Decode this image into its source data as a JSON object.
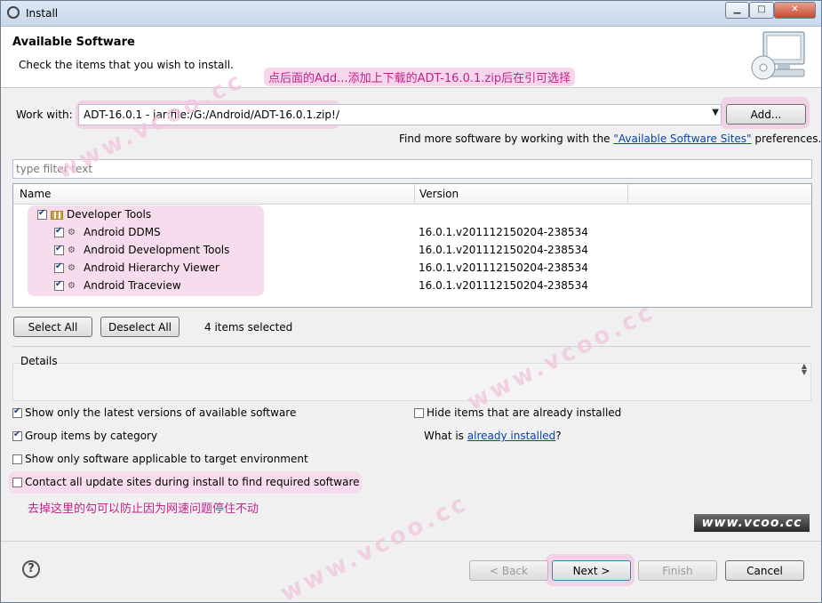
{
  "window": {
    "title": "Install"
  },
  "header": {
    "title": "Available Software",
    "subtitle": "Check the items that you wish to install.",
    "note": "点后面的Add...添加上下载的ADT-16.0.1.zip后在引可选择"
  },
  "work_with": {
    "label": "Work with:",
    "value": "ADT-16.0.1 - jar:file:/G:/Android/ADT-16.0.1.zip!/",
    "add_label": "Add...",
    "find_more_prefix": "Find more software by working with the ",
    "find_more_link": "\"Available Software Sites\"",
    "find_more_suffix": " preferences."
  },
  "filter": {
    "placeholder": "type filter text"
  },
  "tree": {
    "columns": [
      "Name",
      "Version"
    ],
    "category": {
      "name": "Developer Tools",
      "checked": true
    },
    "items": [
      {
        "name": "Android DDMS",
        "version": "16.0.1.v201112150204-238534",
        "checked": true
      },
      {
        "name": "Android Development Tools",
        "version": "16.0.1.v201112150204-238534",
        "checked": true
      },
      {
        "name": "Android Hierarchy Viewer",
        "version": "16.0.1.v201112150204-238534",
        "checked": true
      },
      {
        "name": "Android Traceview",
        "version": "16.0.1.v201112150204-238534",
        "checked": true
      }
    ]
  },
  "selection": {
    "select_all": "Select All",
    "deselect_all": "Deselect All",
    "count_text": "4 items selected"
  },
  "details": {
    "title": "Details"
  },
  "options": {
    "show_latest": {
      "label": "Show only the latest versions of available software",
      "checked": true
    },
    "hide_installed": {
      "label": "Hide items that are already installed",
      "checked": false
    },
    "group_by_category": {
      "label": "Group items by category",
      "checked": true
    },
    "what_is_prefix": "What is ",
    "what_is_link": "already installed",
    "what_is_suffix": "?",
    "applicable_only": {
      "label": "Show only software applicable to target environment",
      "checked": false
    },
    "contact_sites": {
      "label": "Contact all update sites during install to find required software",
      "checked": false
    },
    "note": "去掉这里的勾可以防止因为网速问题停住不动"
  },
  "watermarks": [
    "www.vcoo.cc",
    "www.vcoo.cc",
    "www.vcoo.cc",
    "www.vcoo.cc"
  ],
  "footer": {
    "help_icon": "?",
    "back": "< Back",
    "next": "Next >",
    "finish": "Finish",
    "cancel": "Cancel"
  },
  "window_buttons": {
    "minimize": "▁",
    "maximize": "□",
    "close": "✕"
  },
  "colors": {
    "highlight": "#f3d2e7",
    "note_text": "#c0238d",
    "link": "#0645ad"
  }
}
